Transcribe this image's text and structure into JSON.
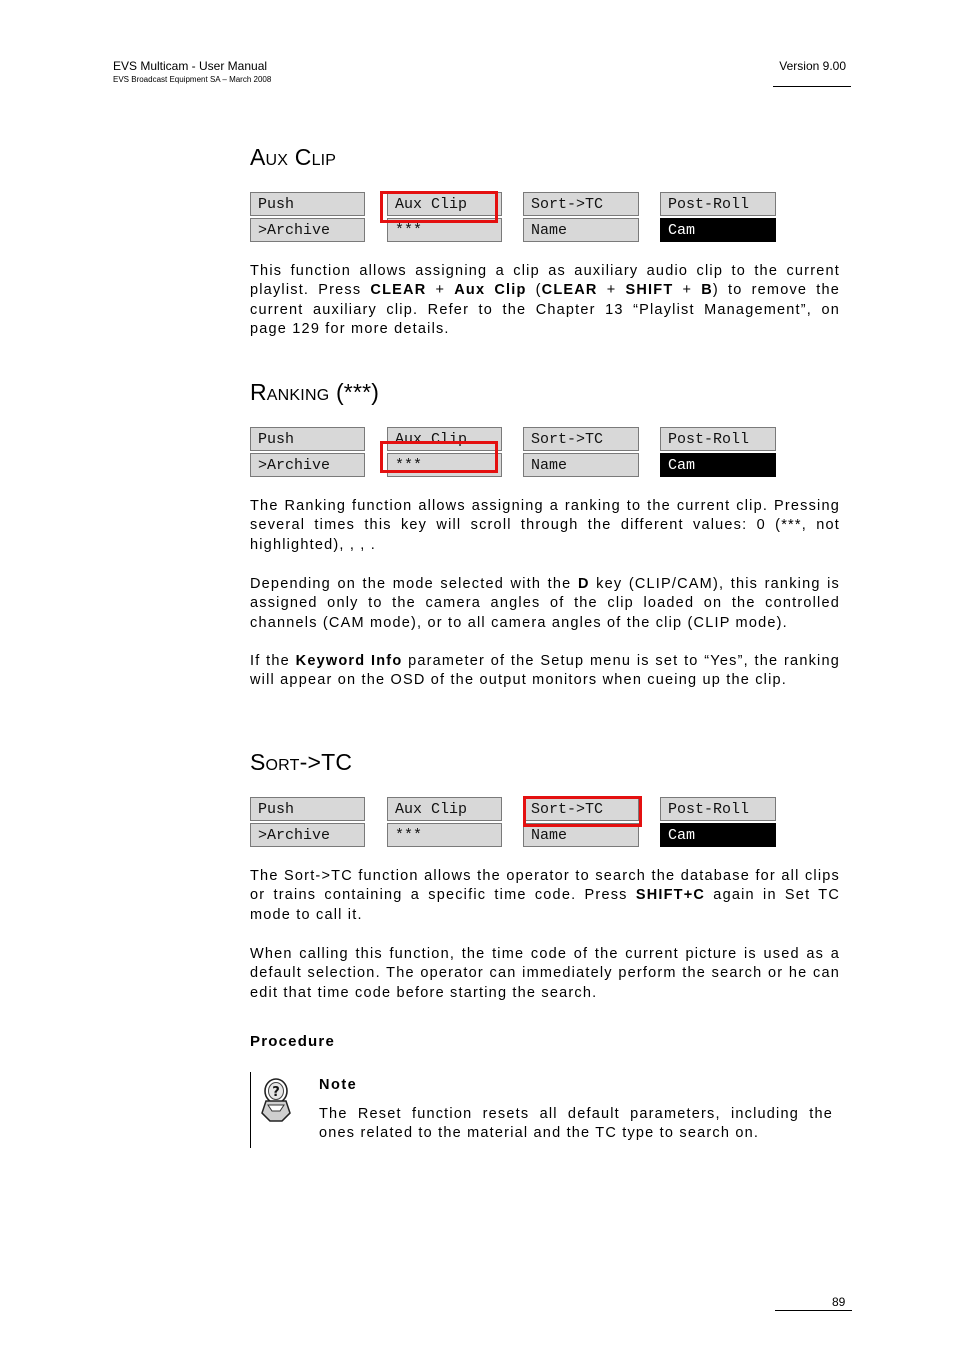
{
  "header": {
    "title": "EVS Multicam - User Manual",
    "subtitle": "EVS Broadcast Equipment SA – March 2008",
    "version": "Version 9.00"
  },
  "sections": {
    "aux_clip": {
      "heading": "Aux Clip",
      "grid": {
        "row1": [
          "Push",
          "Aux Clip",
          "Sort->TC",
          "Post-Roll"
        ],
        "row2": [
          ">Archive",
          "***",
          "Name",
          "Cam"
        ]
      },
      "para1": {
        "t1": "This function allows assigning a clip as auxiliary audio clip to the current playlist. Press ",
        "b1": "CLEAR",
        "t2": " + ",
        "b2": "Aux Clip",
        "t3": " (",
        "b3": "CLEAR",
        "t4": " + ",
        "b4": "SHIFT",
        "t5": " + ",
        "b5": "B",
        "t6": ") to remove the current auxiliary clip. Refer to the Chapter 13 “Playlist Management”, on page 129 for more details."
      }
    },
    "ranking": {
      "heading": "Ranking (***)",
      "grid": {
        "row1": [
          "Push",
          "Aux Clip",
          "Sort->TC",
          "Post-Roll"
        ],
        "row2": [
          ">Archive",
          "***",
          "Name",
          "Cam"
        ]
      },
      "para1": "The Ranking function allows assigning a ranking to the current clip. Pressing several times this key will scroll through the different values: 0 (***, not highlighted),        ,        ,       .",
      "para2": {
        "t1": "Depending on the mode selected with the ",
        "b1": "D",
        "t2": " key (CLIP/CAM), this ranking is assigned only to the camera angles of the clip loaded on the controlled channels (CAM mode), or to all camera angles of the clip (CLIP mode)."
      },
      "para3": {
        "t1": "If the ",
        "b1": "Keyword Info",
        "t2": " parameter of the Setup menu is set to “Yes”, the ranking will appear on the OSD of the output monitors when cueing up the clip."
      }
    },
    "sort_tc": {
      "heading": "Sort->TC",
      "grid": {
        "row1": [
          "Push",
          "Aux Clip",
          "Sort->TC",
          "Post-Roll"
        ],
        "row2": [
          ">Archive",
          "***",
          "Name",
          "Cam"
        ]
      },
      "para1": {
        "t1": "The Sort->TC function allows the operator to search the database for all clips or trains containing a specific time code. Press ",
        "b1": "SHIFT+C",
        "t2": " again in Set TC mode to call it."
      },
      "para2": "When calling this function, the time code of the current picture is used as a default selection. The operator can immediately perform the search or he can edit that time code before starting the search.",
      "procedure": "Procedure"
    }
  },
  "note": {
    "icon": "note-icon",
    "title": "Note",
    "text": "The Reset function resets all default parameters, including the ones related to the material and the TC type to search on."
  },
  "footer": {
    "page_number": "89"
  },
  "colors": {
    "highlight": "#e41010",
    "key_bg": "#d8d8d8",
    "key_dark": "#000000"
  }
}
